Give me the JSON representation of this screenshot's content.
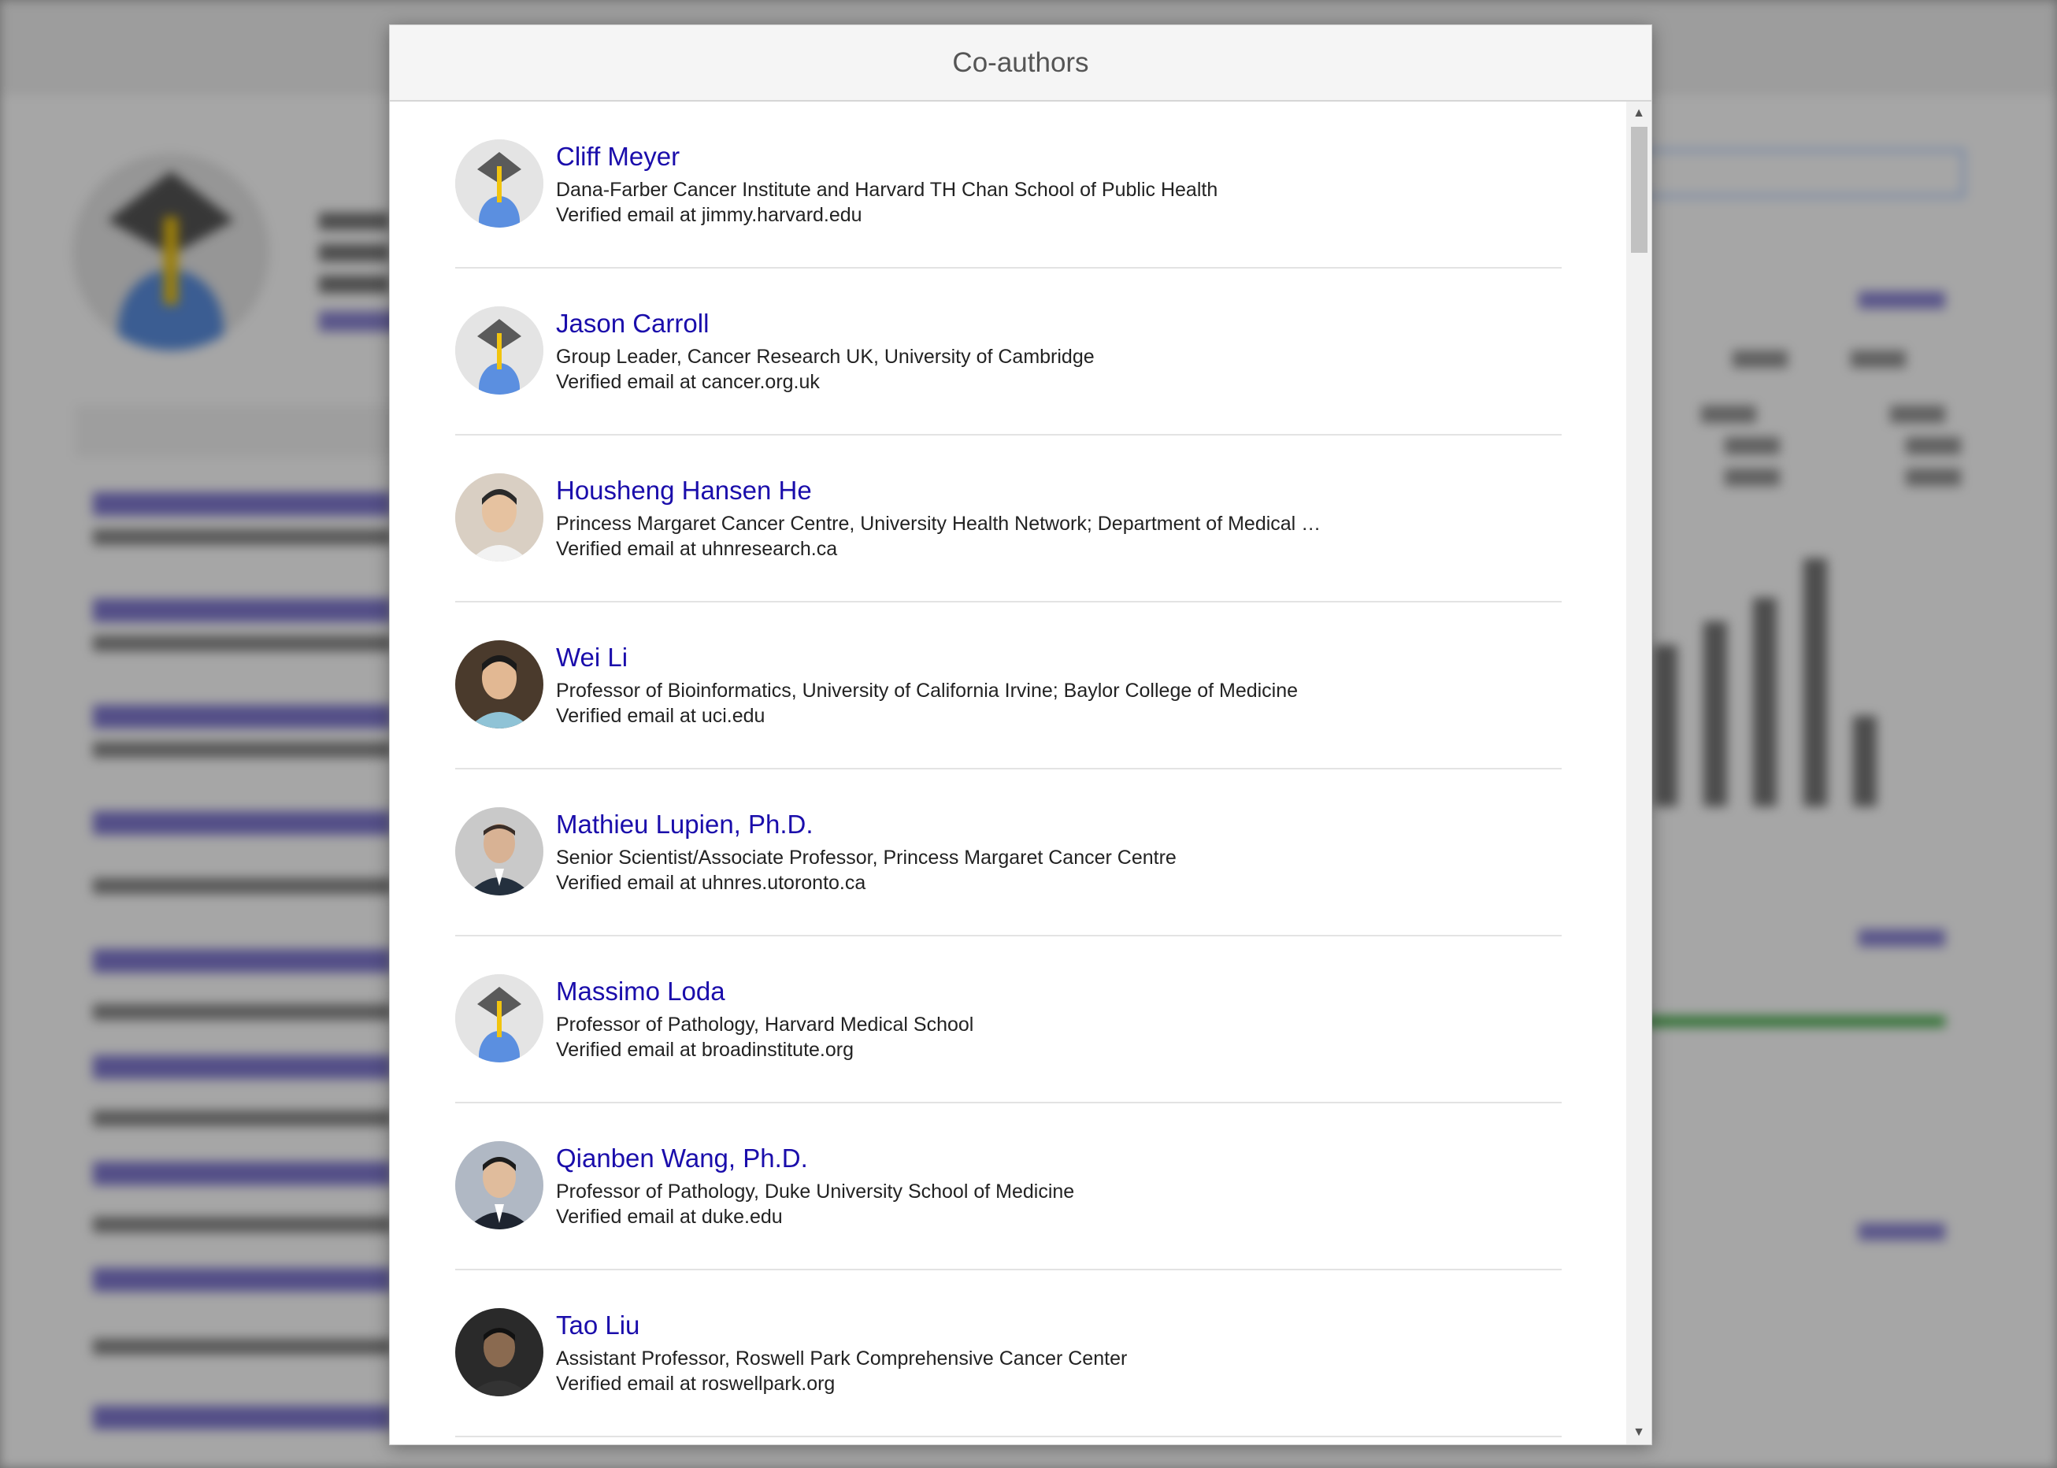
{
  "dialog": {
    "title": "Co-authors"
  },
  "coauthors": [
    {
      "name": "Cliff Meyer",
      "affiliation": "Dana-Farber Cancer Institute and Harvard TH Chan School of Public Health",
      "email": "Verified email at jimmy.harvard.edu",
      "avatar": "default-graduate-avatar"
    },
    {
      "name": "Jason Carroll",
      "affiliation": "Group Leader, Cancer Research UK, University of Cambridge",
      "email": "Verified email at cancer.org.uk",
      "avatar": "default-graduate-avatar"
    },
    {
      "name": "Housheng Hansen He",
      "affiliation": "Princess Margaret Cancer Centre, University Health Network; Department of Medical …",
      "email": "Verified email at uhnresearch.ca",
      "avatar": "photo"
    },
    {
      "name": "Wei Li",
      "affiliation": "Professor of Bioinformatics, University of California Irvine; Baylor College of Medicine",
      "email": "Verified email at uci.edu",
      "avatar": "photo"
    },
    {
      "name": "Mathieu Lupien, Ph.D.",
      "affiliation": "Senior Scientist/Associate Professor, Princess Margaret Cancer Centre",
      "email": "Verified email at uhnres.utoronto.ca",
      "avatar": "photo"
    },
    {
      "name": "Massimo Loda",
      "affiliation": "Professor of Pathology, Harvard Medical School",
      "email": "Verified email at broadinstitute.org",
      "avatar": "default-graduate-avatar"
    },
    {
      "name": "Qianben Wang, Ph.D.",
      "affiliation": "Professor of Pathology, Duke University School of Medicine",
      "email": "Verified email at duke.edu",
      "avatar": "photo"
    },
    {
      "name": "Tao Liu",
      "affiliation": "Assistant Professor, Roswell Park Comprehensive Cancer Center",
      "email": "Verified email at roswellpark.org",
      "avatar": "photo"
    }
  ],
  "colors": {
    "link": "#1a0dab",
    "header_bg": "#f5f5f5",
    "graduate_blue": "#5b8fe0"
  }
}
